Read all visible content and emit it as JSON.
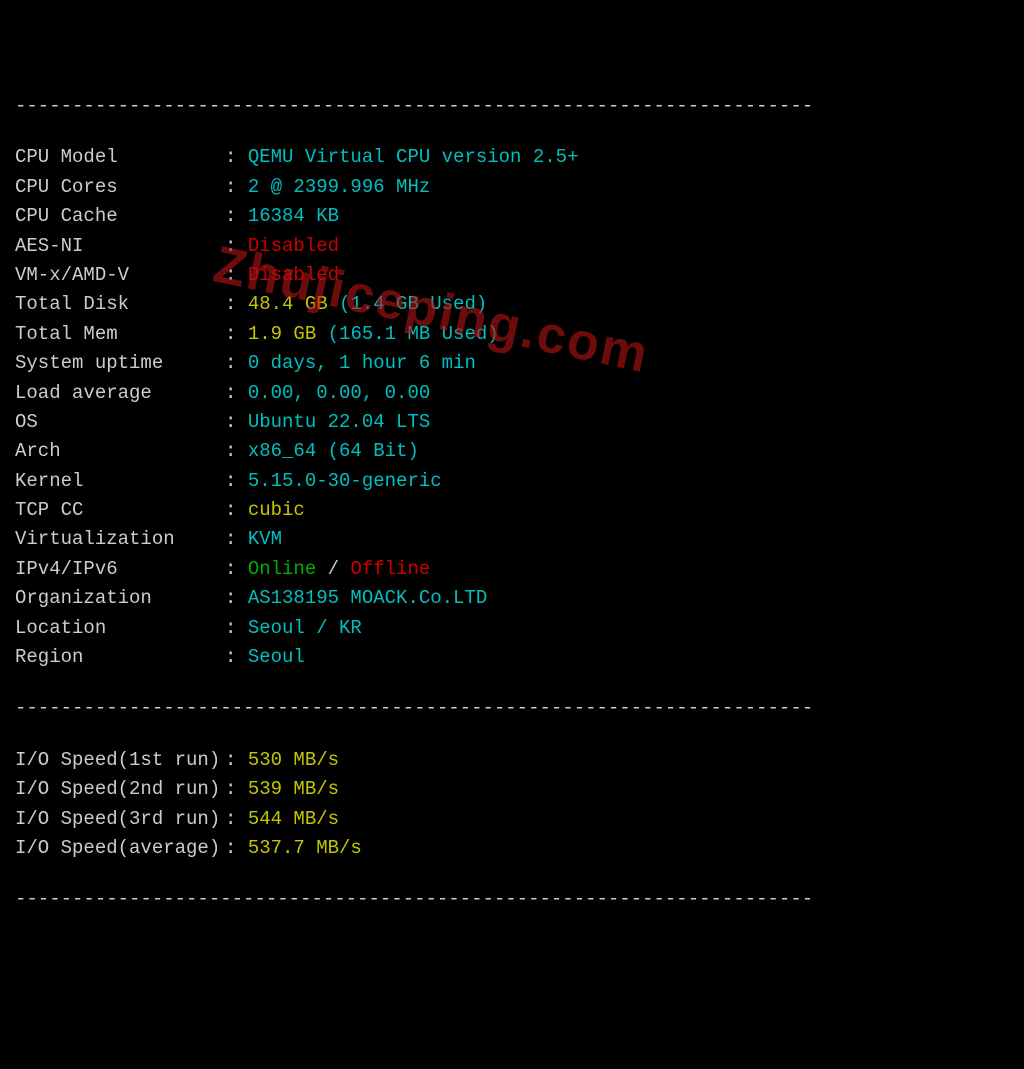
{
  "dashes_line": "----------------------------------------------------------------------",
  "rows": [
    {
      "label": "CPU Model          ",
      "parts": [
        {
          "cls": "cyan",
          "text": "QEMU Virtual CPU version 2.5+"
        }
      ]
    },
    {
      "label": "CPU Cores          ",
      "parts": [
        {
          "cls": "cyan",
          "text": "2 @ 2399.996 MHz"
        }
      ]
    },
    {
      "label": "CPU Cache          ",
      "parts": [
        {
          "cls": "cyan",
          "text": "16384 KB"
        }
      ]
    },
    {
      "label": "AES-NI             ",
      "parts": [
        {
          "cls": "red",
          "text": "Disabled"
        }
      ]
    },
    {
      "label": "VM-x/AMD-V         ",
      "parts": [
        {
          "cls": "red",
          "text": "Disabled"
        }
      ]
    },
    {
      "label": "Total Disk         ",
      "parts": [
        {
          "cls": "yellow",
          "text": "48.4 GB"
        },
        {
          "cls": "cyan",
          "text": " (1.4 GB Used)"
        }
      ]
    },
    {
      "label": "Total Mem          ",
      "parts": [
        {
          "cls": "yellow",
          "text": "1.9 GB"
        },
        {
          "cls": "cyan",
          "text": " (165.1 MB Used)"
        }
      ]
    },
    {
      "label": "System uptime      ",
      "parts": [
        {
          "cls": "cyan",
          "text": "0 days, 1 hour 6 min"
        }
      ]
    },
    {
      "label": "Load average       ",
      "parts": [
        {
          "cls": "cyan",
          "text": "0.00, 0.00, 0.00"
        }
      ]
    },
    {
      "label": "OS                 ",
      "parts": [
        {
          "cls": "cyan",
          "text": "Ubuntu 22.04 LTS"
        }
      ]
    },
    {
      "label": "Arch               ",
      "parts": [
        {
          "cls": "cyan",
          "text": "x86_64 (64 Bit)"
        }
      ]
    },
    {
      "label": "Kernel             ",
      "parts": [
        {
          "cls": "cyan",
          "text": "5.15.0-30-generic"
        }
      ]
    },
    {
      "label": "TCP CC             ",
      "parts": [
        {
          "cls": "yellow",
          "text": "cubic"
        }
      ]
    },
    {
      "label": "Virtualization     ",
      "parts": [
        {
          "cls": "cyan",
          "text": "KVM"
        }
      ]
    },
    {
      "label": "IPv4/IPv6          ",
      "parts": [
        {
          "cls": "green",
          "text": "Online"
        },
        {
          "cls": "white",
          "text": " / "
        },
        {
          "cls": "red",
          "text": "Offline"
        }
      ]
    },
    {
      "label": "Organization       ",
      "parts": [
        {
          "cls": "cyan",
          "text": "AS138195 MOACK.Co.LTD"
        }
      ]
    },
    {
      "label": "Location           ",
      "parts": [
        {
          "cls": "cyan",
          "text": "Seoul / KR"
        }
      ]
    },
    {
      "label": "Region             ",
      "parts": [
        {
          "cls": "cyan",
          "text": "Seoul"
        }
      ]
    }
  ],
  "io_rows": [
    {
      "label": "I/O Speed(1st run) ",
      "parts": [
        {
          "cls": "yellow",
          "text": "530 MB/s"
        }
      ]
    },
    {
      "label": "I/O Speed(2nd run) ",
      "parts": [
        {
          "cls": "yellow",
          "text": "539 MB/s"
        }
      ]
    },
    {
      "label": "I/O Speed(3rd run) ",
      "parts": [
        {
          "cls": "yellow",
          "text": "544 MB/s"
        }
      ]
    },
    {
      "label": "I/O Speed(average) ",
      "parts": [
        {
          "cls": "yellow",
          "text": "537.7 MB/s"
        }
      ]
    }
  ],
  "watermark": "Zhujiceping.com"
}
